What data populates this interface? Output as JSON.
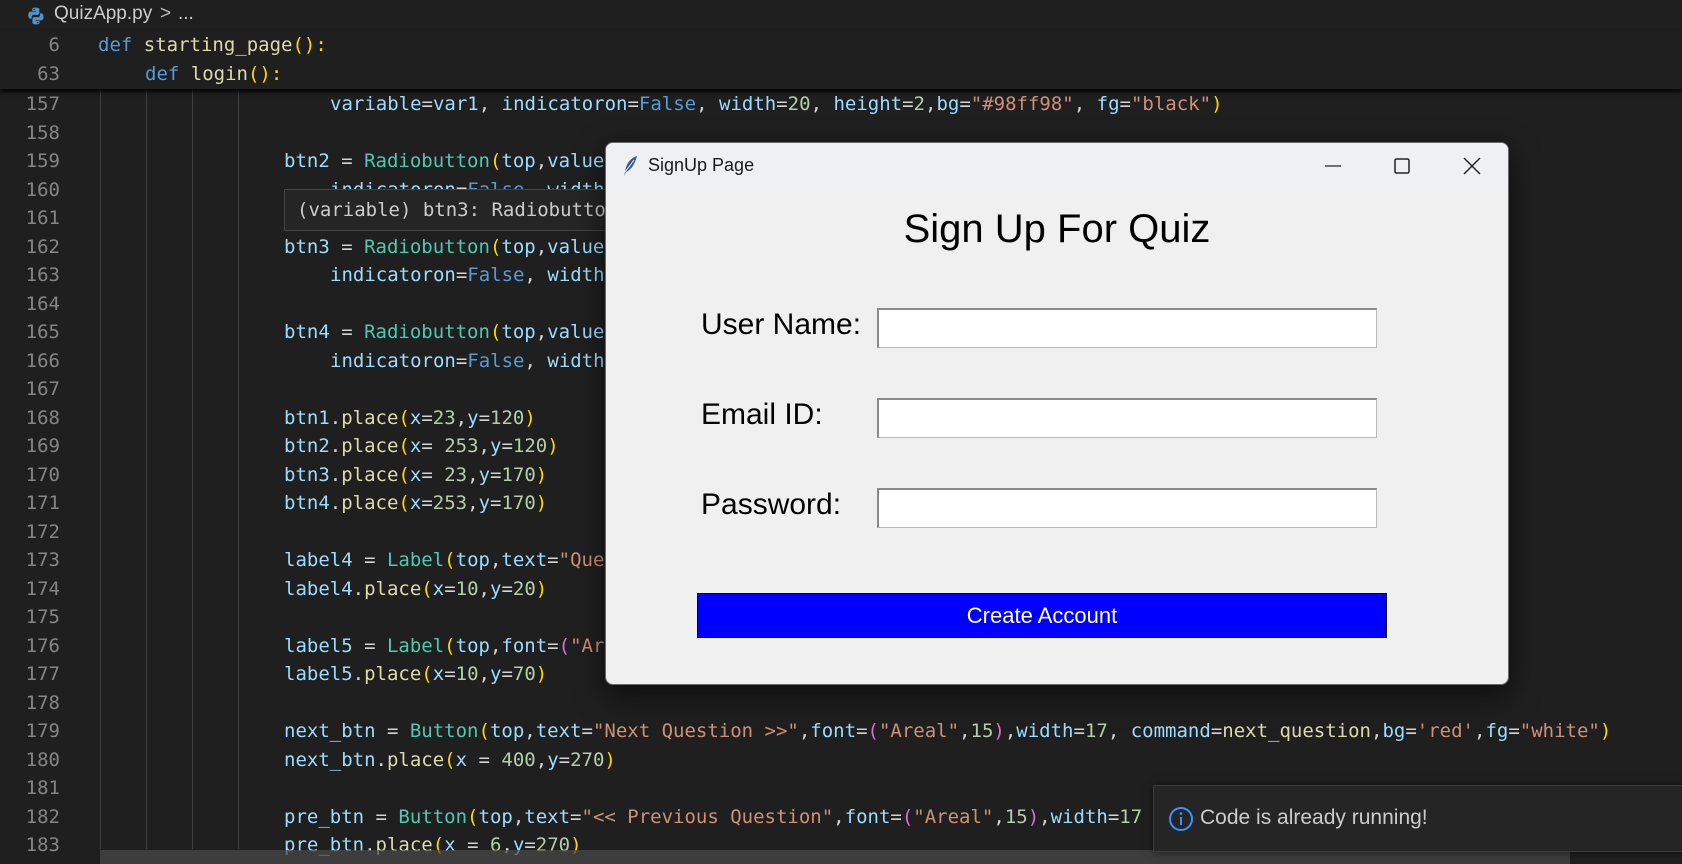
{
  "breadcrumb": {
    "file": "QuizApp.py",
    "separator": ">",
    "more": "..."
  },
  "sticky": [
    {
      "num": "6",
      "indent": 98,
      "tokens": [
        [
          "kw",
          "def "
        ],
        [
          "fn",
          "starting_page"
        ],
        [
          "p1",
          "():"
        ]
      ]
    },
    {
      "num": "63",
      "indent": 145,
      "tokens": [
        [
          "kw",
          "def "
        ],
        [
          "fn",
          "login"
        ],
        [
          "p1",
          "():"
        ]
      ]
    }
  ],
  "code_lines": [
    {
      "num": "157",
      "indent": 330,
      "tokens": [
        [
          "var",
          "variable"
        ],
        [
          "op",
          "="
        ],
        [
          "var",
          "var1"
        ],
        [
          "op",
          ", "
        ],
        [
          "var",
          "indicatoron"
        ],
        [
          "op",
          "="
        ],
        [
          "bool",
          "False"
        ],
        [
          "op",
          ", "
        ],
        [
          "var",
          "width"
        ],
        [
          "op",
          "="
        ],
        [
          "num",
          "20"
        ],
        [
          "op",
          ", "
        ],
        [
          "var",
          "height"
        ],
        [
          "op",
          "="
        ],
        [
          "num",
          "2"
        ],
        [
          "op",
          ","
        ],
        [
          "var",
          "bg"
        ],
        [
          "op",
          "="
        ],
        [
          "str",
          "\"#98ff98\""
        ],
        [
          "op",
          ", "
        ],
        [
          "var",
          "fg"
        ],
        [
          "op",
          "="
        ],
        [
          "str",
          "\"black\""
        ],
        [
          "p1",
          ")"
        ]
      ]
    },
    {
      "num": "158",
      "indent": 284,
      "tokens": []
    },
    {
      "num": "159",
      "indent": 284,
      "tokens": [
        [
          "var",
          "btn2"
        ],
        [
          "op",
          " = "
        ],
        [
          "cls",
          "Radiobutton"
        ],
        [
          "p1",
          "("
        ],
        [
          "var",
          "top"
        ],
        [
          "op",
          ","
        ],
        [
          "var",
          "value"
        ]
      ]
    },
    {
      "num": "160",
      "indent": 330,
      "tokens": [
        [
          "var",
          "indicatoron"
        ],
        [
          "op",
          "="
        ],
        [
          "bool",
          "False"
        ],
        [
          "op",
          ", "
        ],
        [
          "var",
          "width"
        ]
      ]
    },
    {
      "num": "161",
      "indent": 284,
      "tokens": []
    },
    {
      "num": "162",
      "indent": 284,
      "tokens": [
        [
          "var",
          "btn3"
        ],
        [
          "op",
          " = "
        ],
        [
          "cls",
          "Radiobutton"
        ],
        [
          "p1",
          "("
        ],
        [
          "var",
          "top"
        ],
        [
          "op",
          ","
        ],
        [
          "var",
          "value"
        ]
      ]
    },
    {
      "num": "163",
      "indent": 330,
      "tokens": [
        [
          "var",
          "indicatoron"
        ],
        [
          "op",
          "="
        ],
        [
          "bool",
          "False"
        ],
        [
          "op",
          ", "
        ],
        [
          "var",
          "width"
        ]
      ]
    },
    {
      "num": "164",
      "indent": 284,
      "tokens": []
    },
    {
      "num": "165",
      "indent": 284,
      "tokens": [
        [
          "var",
          "btn4"
        ],
        [
          "op",
          " = "
        ],
        [
          "cls",
          "Radiobutton"
        ],
        [
          "p1",
          "("
        ],
        [
          "var",
          "top"
        ],
        [
          "op",
          ","
        ],
        [
          "var",
          "value"
        ]
      ]
    },
    {
      "num": "166",
      "indent": 330,
      "tokens": [
        [
          "var",
          "indicatoron"
        ],
        [
          "op",
          "="
        ],
        [
          "bool",
          "False"
        ],
        [
          "op",
          ", "
        ],
        [
          "var",
          "width"
        ]
      ]
    },
    {
      "num": "167",
      "indent": 284,
      "tokens": []
    },
    {
      "num": "168",
      "indent": 284,
      "tokens": [
        [
          "var",
          "btn1"
        ],
        [
          "op",
          "."
        ],
        [
          "fn",
          "place"
        ],
        [
          "p1",
          "("
        ],
        [
          "var",
          "x"
        ],
        [
          "op",
          "="
        ],
        [
          "num",
          "23"
        ],
        [
          "op",
          ","
        ],
        [
          "var",
          "y"
        ],
        [
          "op",
          "="
        ],
        [
          "num",
          "120"
        ],
        [
          "p1",
          ")"
        ]
      ]
    },
    {
      "num": "169",
      "indent": 284,
      "tokens": [
        [
          "var",
          "btn2"
        ],
        [
          "op",
          "."
        ],
        [
          "fn",
          "place"
        ],
        [
          "p1",
          "("
        ],
        [
          "var",
          "x"
        ],
        [
          "op",
          "= "
        ],
        [
          "num",
          "253"
        ],
        [
          "op",
          ","
        ],
        [
          "var",
          "y"
        ],
        [
          "op",
          "="
        ],
        [
          "num",
          "120"
        ],
        [
          "p1",
          ")"
        ]
      ]
    },
    {
      "num": "170",
      "indent": 284,
      "tokens": [
        [
          "var",
          "btn3"
        ],
        [
          "op",
          "."
        ],
        [
          "fn",
          "place"
        ],
        [
          "p1",
          "("
        ],
        [
          "var",
          "x"
        ],
        [
          "op",
          "= "
        ],
        [
          "num",
          "23"
        ],
        [
          "op",
          ","
        ],
        [
          "var",
          "y"
        ],
        [
          "op",
          "="
        ],
        [
          "num",
          "170"
        ],
        [
          "p1",
          ")"
        ]
      ]
    },
    {
      "num": "171",
      "indent": 284,
      "tokens": [
        [
          "var",
          "btn4"
        ],
        [
          "op",
          "."
        ],
        [
          "fn",
          "place"
        ],
        [
          "p1",
          "("
        ],
        [
          "var",
          "x"
        ],
        [
          "op",
          "="
        ],
        [
          "num",
          "253"
        ],
        [
          "op",
          ","
        ],
        [
          "var",
          "y"
        ],
        [
          "op",
          "="
        ],
        [
          "num",
          "170"
        ],
        [
          "p1",
          ")"
        ]
      ]
    },
    {
      "num": "172",
      "indent": 284,
      "tokens": []
    },
    {
      "num": "173",
      "indent": 284,
      "tokens": [
        [
          "var",
          "label4"
        ],
        [
          "op",
          " = "
        ],
        [
          "cls",
          "Label"
        ],
        [
          "p1",
          "("
        ],
        [
          "var",
          "top"
        ],
        [
          "op",
          ","
        ],
        [
          "var",
          "text"
        ],
        [
          "op",
          "="
        ],
        [
          "str",
          "\"Que"
        ]
      ]
    },
    {
      "num": "174",
      "indent": 284,
      "tokens": [
        [
          "var",
          "label4"
        ],
        [
          "op",
          "."
        ],
        [
          "fn",
          "place"
        ],
        [
          "p1",
          "("
        ],
        [
          "var",
          "x"
        ],
        [
          "op",
          "="
        ],
        [
          "num",
          "10"
        ],
        [
          "op",
          ","
        ],
        [
          "var",
          "y"
        ],
        [
          "op",
          "="
        ],
        [
          "num",
          "20"
        ],
        [
          "p1",
          ")"
        ]
      ]
    },
    {
      "num": "175",
      "indent": 284,
      "tokens": []
    },
    {
      "num": "176",
      "indent": 284,
      "tokens": [
        [
          "var",
          "label5"
        ],
        [
          "op",
          " = "
        ],
        [
          "cls",
          "Label"
        ],
        [
          "p1",
          "("
        ],
        [
          "var",
          "top"
        ],
        [
          "op",
          ","
        ],
        [
          "var",
          "font"
        ],
        [
          "op",
          "="
        ],
        [
          "p2",
          "("
        ],
        [
          "str",
          "\"Ar"
        ]
      ]
    },
    {
      "num": "177",
      "indent": 284,
      "tokens": [
        [
          "var",
          "label5"
        ],
        [
          "op",
          "."
        ],
        [
          "fn",
          "place"
        ],
        [
          "p1",
          "("
        ],
        [
          "var",
          "x"
        ],
        [
          "op",
          "="
        ],
        [
          "num",
          "10"
        ],
        [
          "op",
          ","
        ],
        [
          "var",
          "y"
        ],
        [
          "op",
          "="
        ],
        [
          "num",
          "70"
        ],
        [
          "p1",
          ")"
        ]
      ]
    },
    {
      "num": "178",
      "indent": 284,
      "tokens": []
    },
    {
      "num": "179",
      "indent": 284,
      "tokens": [
        [
          "var",
          "next_btn"
        ],
        [
          "op",
          " = "
        ],
        [
          "cls",
          "Button"
        ],
        [
          "p1",
          "("
        ],
        [
          "var",
          "top"
        ],
        [
          "op",
          ","
        ],
        [
          "var",
          "text"
        ],
        [
          "op",
          "="
        ],
        [
          "str",
          "\"Next Question >>\""
        ],
        [
          "op",
          ","
        ],
        [
          "var",
          "font"
        ],
        [
          "op",
          "="
        ],
        [
          "p2",
          "("
        ],
        [
          "str",
          "\"Areal\""
        ],
        [
          "op",
          ","
        ],
        [
          "num",
          "15"
        ],
        [
          "p2",
          ")"
        ],
        [
          "op",
          ","
        ],
        [
          "var",
          "width"
        ],
        [
          "op",
          "="
        ],
        [
          "num",
          "17"
        ],
        [
          "op",
          ", "
        ],
        [
          "var",
          "command"
        ],
        [
          "op",
          "="
        ],
        [
          "fn",
          "next_question"
        ],
        [
          "op",
          ","
        ],
        [
          "var",
          "bg"
        ],
        [
          "op",
          "="
        ],
        [
          "str",
          "'red'"
        ],
        [
          "op",
          ","
        ],
        [
          "var",
          "fg"
        ],
        [
          "op",
          "="
        ],
        [
          "str",
          "\"white\""
        ],
        [
          "p1",
          ")"
        ]
      ]
    },
    {
      "num": "180",
      "indent": 284,
      "tokens": [
        [
          "var",
          "next_btn"
        ],
        [
          "op",
          "."
        ],
        [
          "fn",
          "place"
        ],
        [
          "p1",
          "("
        ],
        [
          "var",
          "x"
        ],
        [
          "op",
          " = "
        ],
        [
          "num",
          "400"
        ],
        [
          "op",
          ","
        ],
        [
          "var",
          "y"
        ],
        [
          "op",
          "="
        ],
        [
          "num",
          "270"
        ],
        [
          "p1",
          ")"
        ]
      ]
    },
    {
      "num": "181",
      "indent": 284,
      "tokens": []
    },
    {
      "num": "182",
      "indent": 284,
      "tokens": [
        [
          "var",
          "pre_btn"
        ],
        [
          "op",
          " = "
        ],
        [
          "cls",
          "Button"
        ],
        [
          "p1",
          "("
        ],
        [
          "var",
          "top"
        ],
        [
          "op",
          ","
        ],
        [
          "var",
          "text"
        ],
        [
          "op",
          "="
        ],
        [
          "str",
          "\"<< Previous Question\""
        ],
        [
          "op",
          ","
        ],
        [
          "var",
          "font"
        ],
        [
          "op",
          "="
        ],
        [
          "p2",
          "("
        ],
        [
          "str",
          "\"Areal\""
        ],
        [
          "op",
          ","
        ],
        [
          "num",
          "15"
        ],
        [
          "p2",
          ")"
        ],
        [
          "op",
          ","
        ],
        [
          "var",
          "width"
        ],
        [
          "op",
          "="
        ],
        [
          "num",
          "17"
        ]
      ]
    },
    {
      "num": "183",
      "indent": 284,
      "tokens": [
        [
          "var",
          "pre_btn"
        ],
        [
          "op",
          "."
        ],
        [
          "fn",
          "place"
        ],
        [
          "p1",
          "("
        ],
        [
          "var",
          "x"
        ],
        [
          "op",
          " = "
        ],
        [
          "num",
          "6"
        ],
        [
          "op",
          ","
        ],
        [
          "var",
          "y"
        ],
        [
          "op",
          "="
        ],
        [
          "num",
          "270"
        ],
        [
          "p1",
          ")"
        ]
      ]
    }
  ],
  "hover": {
    "text": "(variable) btn3: Radiobutto"
  },
  "tk_window": {
    "title": "SignUp Page",
    "heading": "Sign Up For Quiz",
    "fields": [
      {
        "label": "User Name:",
        "value": ""
      },
      {
        "label": "Email ID:",
        "value": ""
      },
      {
        "label": "Password:",
        "value": ""
      }
    ],
    "button": "Create Account",
    "button_color": "#0000ff"
  },
  "toast": {
    "message": "Code is already running!",
    "icon": "info-icon"
  },
  "colors": {
    "editor_bg": "#1f1f1f",
    "window_bg": "#f0f0f0"
  }
}
